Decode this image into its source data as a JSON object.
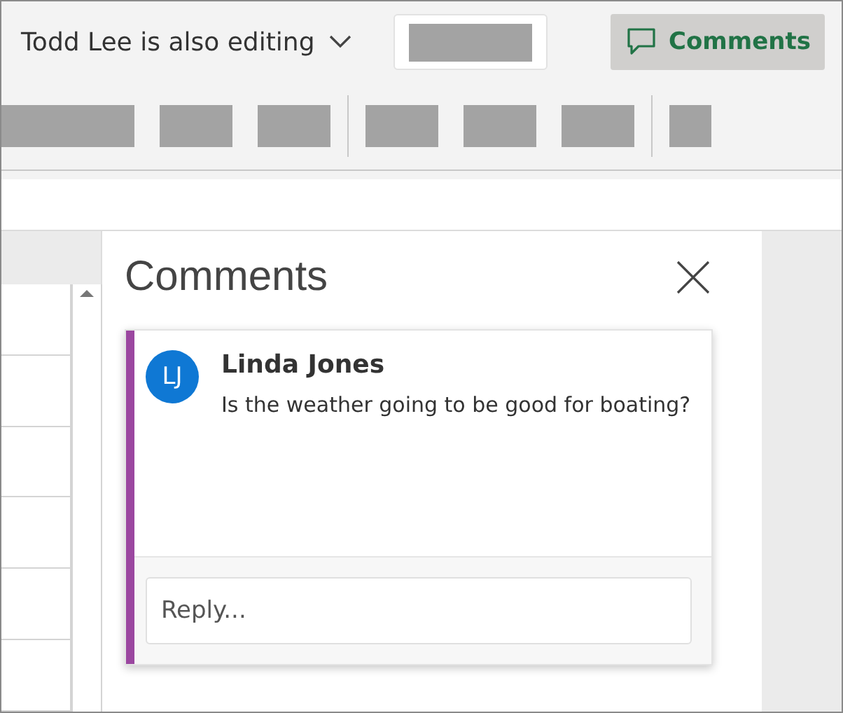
{
  "header": {
    "coauthor_label": "Todd Lee is also editing",
    "comments_button": {
      "label": "Comments",
      "on": true
    }
  },
  "comments_pane": {
    "title": "Comments",
    "thread": {
      "initials": "LJ",
      "author": "Linda Jones",
      "text": "Is the weather going to be good for boating?",
      "color": "#9b47a0"
    },
    "reply": {
      "placeholder": "Reply..."
    }
  }
}
